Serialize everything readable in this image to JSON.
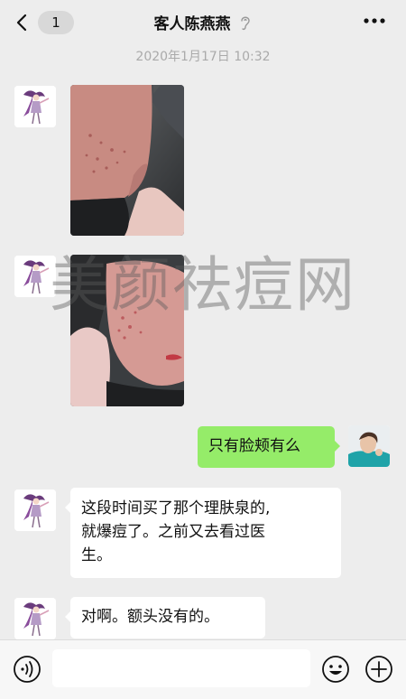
{
  "header": {
    "unread_count": "1",
    "title": "客人陈燕燕"
  },
  "timestamp": "2020年1月17日 10:32",
  "watermark": "美颜祛痘网",
  "messages": [
    {
      "sender": "customer",
      "type": "image"
    },
    {
      "sender": "customer",
      "type": "image"
    },
    {
      "sender": "me",
      "type": "text",
      "text": "只有脸颊有么"
    },
    {
      "sender": "customer",
      "type": "text",
      "lines": [
        "这段时间买了那个理肤泉的,",
        "就爆痘了。之前又去看过医",
        "生。"
      ]
    },
    {
      "sender": "customer",
      "type": "text",
      "text": "对啊。额头没有的。"
    }
  ],
  "composer": {
    "input_value": ""
  },
  "icons": {
    "back": "chevron-left-icon",
    "mute": "mute-ear-icon",
    "more": "more-dots-icon",
    "voice": "voice-icon",
    "emoji": "emoji-icon",
    "plus": "plus-icon"
  }
}
